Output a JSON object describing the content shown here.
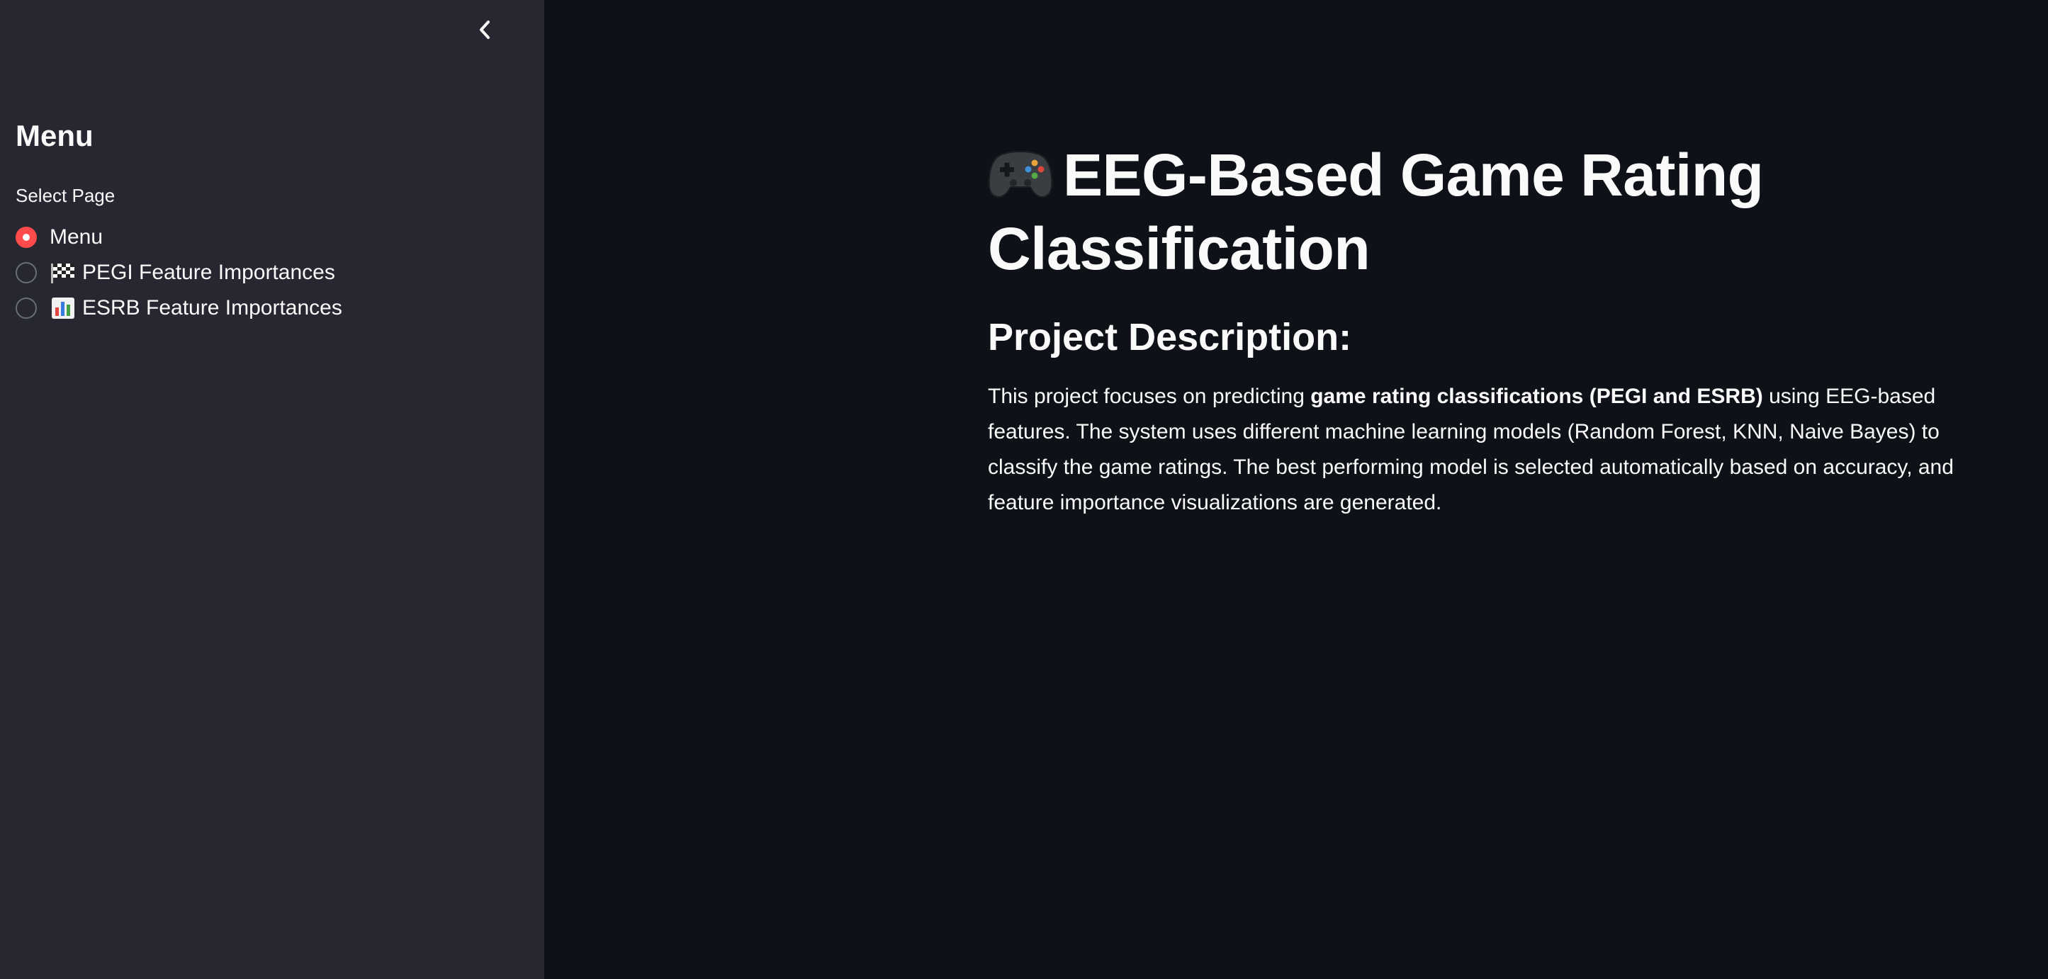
{
  "sidebar": {
    "title": "Menu",
    "radio_label": "Select Page",
    "options": [
      {
        "label": "Menu",
        "icon": "",
        "selected": true
      },
      {
        "label": "PEGI Feature Importances",
        "icon": "checkered-flag-icon",
        "selected": false
      },
      {
        "label": "ESRB Feature Importances",
        "icon": "bar-chart-icon",
        "selected": false
      }
    ]
  },
  "main": {
    "title_icon": "gamepad-icon",
    "title": "EEG-Based Game Rating Classification",
    "section_heading": "Project Description:",
    "description_before": "This project focuses on predicting ",
    "description_bold": "game rating classifications (PEGI and ESRB)",
    "description_after": " using EEG-based features. The system uses different machine learning models (Random Forest, KNN, Naive Bayes) to classify the game ratings. The best performing model is selected automatically based on accuracy, and feature importance visualizations are generated."
  },
  "colors": {
    "sidebar_bg": "#262730",
    "main_bg": "#0e1117",
    "accent": "#ff4b4b",
    "text": "#fafafa"
  }
}
